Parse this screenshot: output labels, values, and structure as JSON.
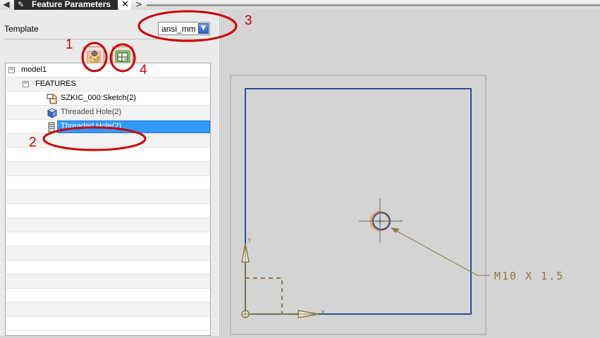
{
  "titlebar": {
    "left_arrow": "◀",
    "pin_icon": "pin-icon",
    "title": "Feature Parameters",
    "close_label": "✕",
    "right_arrow": ">"
  },
  "template": {
    "label": "Template",
    "value": "ansi_mm"
  },
  "toolbar": {
    "buttons": [
      {
        "icon": "feature-part-icon",
        "annotation": "1"
      },
      {
        "icon": "drawing-sheet-icon",
        "annotation": "4"
      }
    ]
  },
  "tree": {
    "items": [
      {
        "label": "model1",
        "expander": "−",
        "icon": "none"
      },
      {
        "label": "FEATURES",
        "expander": "−",
        "icon": "none"
      },
      {
        "label": "SZKIC_000:Sketch(2)",
        "icon": "sketch-icon"
      },
      {
        "label": "Threaded Hole(2)",
        "icon": "part-body-icon"
      },
      {
        "label": "Threaded Hole(2)",
        "icon": "threaded-hole-icon",
        "selected": true,
        "annotation": "2"
      }
    ]
  },
  "annotations": {
    "n1": "1",
    "n2": "2",
    "n3": "3",
    "n4": "4"
  },
  "drawing": {
    "axis_y_label": "Y",
    "axis_x_label": "X",
    "hole_callout": "M10 X 1.5",
    "colors": {
      "part_outline": "#2b4f99",
      "construction": "#8a7a40",
      "hole_highlight": "#f0a050",
      "sheet_frame": "#a0a0a0",
      "annotation_red": "#cc0000"
    }
  }
}
